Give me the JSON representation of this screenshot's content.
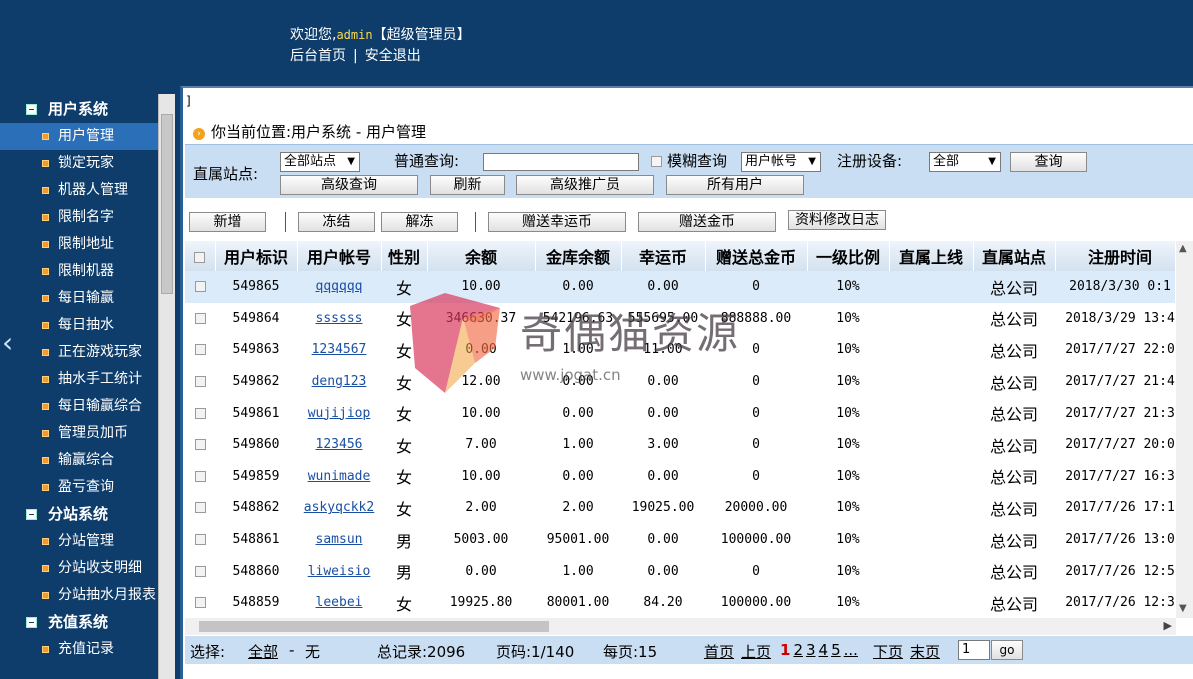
{
  "header": {
    "welcome_prefix": "欢迎您,",
    "username": "admin",
    "role": "【超级管理员】",
    "home_link": "后台首页",
    "separator": "|",
    "logout_link": "安全退出"
  },
  "sidebar": {
    "groups": [
      {
        "label": "用户系统",
        "items": [
          "用户管理",
          "锁定玩家",
          "机器人管理",
          "限制名字",
          "限制地址",
          "限制机器",
          "每日输赢",
          "每日抽水",
          "正在游戏玩家",
          "抽水手工统计",
          "每日输赢综合",
          "管理员加币",
          "输赢综合",
          "盈亏查询"
        ]
      },
      {
        "label": "分站系统",
        "items": [
          "分站管理",
          "分站收支明细",
          "分站抽水月报表"
        ]
      },
      {
        "label": "充值系统",
        "items": [
          "充值记录"
        ]
      }
    ],
    "active_item": "用户管理",
    "collapse_arrow": "‹"
  },
  "main": {
    "stray_char": "]",
    "location": "你当前位置:用户系统 - 用户管理",
    "search": {
      "station_label": "直属站点:",
      "station_value": "全部站点",
      "normal_query_label": "普通查询:",
      "normal_query_value": "",
      "fuzzy_label": "模糊查询",
      "field_value": "用户帐号",
      "device_label": "注册设备:",
      "device_value": "全部",
      "query_btn": "查询",
      "advanced_btn": "高级查询",
      "refresh_btn": "刷新",
      "promoter_btn": "高级推广员",
      "all_users_btn": "所有用户"
    },
    "toolbar": {
      "add": "新增",
      "freeze": "冻结",
      "unfreeze": "解冻",
      "gift_luck": "赠送幸运币",
      "gift_gold": "赠送金币",
      "change_log": "资料修改日志"
    },
    "table": {
      "columns": [
        "用户标识",
        "用户帐号",
        "性别",
        "余额",
        "金库余额",
        "幸运币",
        "赠送总金币",
        "一级比例",
        "直属上线",
        "直属站点",
        "注册时间"
      ],
      "rows": [
        [
          "549865",
          "qqqqqq",
          "女",
          "10.00",
          "0.00",
          "0.00",
          "0",
          "10%",
          "",
          "总公司",
          "2018/3/30 0:1"
        ],
        [
          "549864",
          "ssssss",
          "女",
          "346630.37",
          "542196.63",
          "555695.00",
          "888888.00",
          "10%",
          "",
          "总公司",
          "2018/3/29 13:4"
        ],
        [
          "549863",
          "1234567",
          "女",
          "0.00",
          "1.00",
          "11.00",
          "0",
          "10%",
          "",
          "总公司",
          "2017/7/27 22:0"
        ],
        [
          "549862",
          "deng123",
          "女",
          "12.00",
          "0.00",
          "0.00",
          "0",
          "10%",
          "",
          "总公司",
          "2017/7/27 21:4"
        ],
        [
          "549861",
          "wujijiop",
          "女",
          "10.00",
          "0.00",
          "0.00",
          "0",
          "10%",
          "",
          "总公司",
          "2017/7/27 21:3"
        ],
        [
          "549860",
          "123456",
          "女",
          "7.00",
          "1.00",
          "3.00",
          "0",
          "10%",
          "",
          "总公司",
          "2017/7/27 20:0"
        ],
        [
          "549859",
          "wunimade",
          "女",
          "10.00",
          "0.00",
          "0.00",
          "0",
          "10%",
          "",
          "总公司",
          "2017/7/27 16:3"
        ],
        [
          "548862",
          "askyqckk2",
          "女",
          "2.00",
          "2.00",
          "19025.00",
          "20000.00",
          "10%",
          "",
          "总公司",
          "2017/7/26 17:1"
        ],
        [
          "548861",
          "samsun",
          "男",
          "5003.00",
          "95001.00",
          "0.00",
          "100000.00",
          "10%",
          "",
          "总公司",
          "2017/7/26 13:0"
        ],
        [
          "548860",
          "liweisio",
          "男",
          "0.00",
          "1.00",
          "0.00",
          "0",
          "10%",
          "",
          "总公司",
          "2017/7/26 12:5"
        ],
        [
          "548859",
          "leebei",
          "女",
          "19925.80",
          "80001.00",
          "84.20",
          "100000.00",
          "10%",
          "",
          "总公司",
          "2017/7/26 12:3"
        ]
      ]
    },
    "footer": {
      "select_label": "选择:",
      "select_all": "全部",
      "dash": "-",
      "select_none": "无",
      "total": "总记录:2096",
      "pages": "页码:1/140",
      "per_page": "每页:15",
      "first": "首页",
      "prev": "上页",
      "page_nums": [
        "1",
        "2",
        "3",
        "4",
        "5",
        "..."
      ],
      "next": "下页",
      "last": "末页",
      "goto_value": "1",
      "go_btn": "go"
    }
  },
  "watermark": {
    "text": "奇偶猫资源",
    "url": "www.jogat.cn"
  },
  "colors": {
    "frame_blue": "#0e3d6b",
    "active_item": "#2b6fb8",
    "panel": "#c9def3",
    "link": "#1a4fa3",
    "current_page": "#cc0000"
  }
}
